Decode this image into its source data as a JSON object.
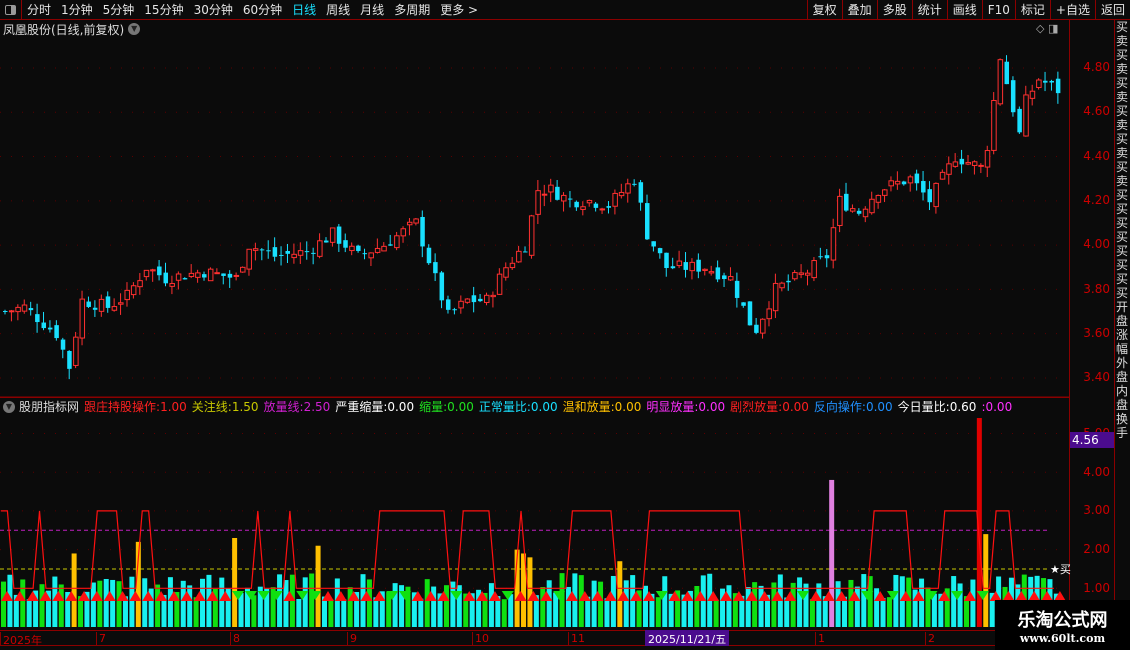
{
  "toolbar": {
    "periods": [
      "分时",
      "1分钟",
      "5分钟",
      "15分钟",
      "30分钟",
      "60分钟",
      "日线",
      "周线",
      "月线",
      "多周期",
      "更多 >"
    ],
    "active_period": "日线",
    "actions": [
      "复权",
      "叠加",
      "多股",
      "统计",
      "画线",
      "F10",
      "标记",
      "+自选",
      "返回"
    ]
  },
  "main": {
    "title": "凤凰股份(日线,前复权)",
    "price_axis": [
      "4.80",
      "4.60",
      "4.40",
      "4.20",
      "4.00",
      "3.80",
      "3.60",
      "3.40"
    ],
    "price_path": [
      [
        0,
        3.7
      ],
      [
        3,
        3.72
      ],
      [
        8,
        3.6
      ],
      [
        10,
        3.45
      ],
      [
        12,
        3.75
      ],
      [
        16,
        3.72
      ],
      [
        19,
        3.77
      ],
      [
        22,
        3.9
      ],
      [
        25,
        3.85
      ],
      [
        31,
        3.88
      ],
      [
        36,
        3.85
      ],
      [
        38,
        4.0
      ],
      [
        42,
        3.95
      ],
      [
        47,
        3.97
      ],
      [
        51,
        4.05
      ],
      [
        55,
        3.95
      ],
      [
        59,
        4.0
      ],
      [
        64,
        4.1
      ],
      [
        69,
        3.68
      ],
      [
        72,
        3.75
      ],
      [
        75,
        3.75
      ],
      [
        78,
        3.9
      ],
      [
        81,
        4.0
      ],
      [
        83,
        4.25
      ],
      [
        85,
        4.25
      ],
      [
        88,
        4.2
      ],
      [
        91,
        4.2
      ],
      [
        94,
        4.18
      ],
      [
        98,
        4.3
      ],
      [
        100,
        4.05
      ],
      [
        103,
        3.9
      ],
      [
        109,
        3.9
      ],
      [
        113,
        3.85
      ],
      [
        116,
        3.65
      ],
      [
        117,
        3.62
      ],
      [
        120,
        3.8
      ],
      [
        125,
        3.88
      ],
      [
        128,
        3.95
      ],
      [
        130,
        4.2
      ],
      [
        133,
        4.15
      ],
      [
        136,
        4.25
      ],
      [
        141,
        4.3
      ],
      [
        144,
        4.2
      ],
      [
        148,
        4.4
      ],
      [
        152,
        4.35
      ],
      [
        153,
        4.45
      ],
      [
        155,
        4.85
      ],
      [
        158,
        4.5
      ],
      [
        159,
        4.65
      ],
      [
        161,
        4.75
      ],
      [
        164,
        4.7
      ]
    ],
    "up_color": "#ff3030",
    "down_color": "#19e0ff"
  },
  "indicator": {
    "name": "股朋指标网",
    "legend": [
      {
        "label": "跟庄持股操作:",
        "value": "1.00",
        "color": "#ff2020"
      },
      {
        "label": "关注线:",
        "value": "1.50",
        "color": "#c8c800"
      },
      {
        "label": "放量线:",
        "value": "2.50",
        "color": "#d020d0"
      },
      {
        "label": "严重缩量:",
        "value": "0.00",
        "color": "#ffffff"
      },
      {
        "label": "缩量:",
        "value": "0.00",
        "color": "#20e020"
      },
      {
        "label": "正常量比:",
        "value": "0.00",
        "color": "#19e0ff"
      },
      {
        "label": "温和放量:",
        "value": "0.00",
        "color": "#ffc000"
      },
      {
        "label": "明显放量:",
        "value": "0.00",
        "color": "#ff30ff"
      },
      {
        "label": "剧烈放量:",
        "value": "0.00",
        "color": "#ff2020"
      },
      {
        "label": "反向操作:",
        "value": "0.00",
        "color": "#2090ff"
      },
      {
        "label": "今日量比:",
        "value": "0.60",
        "color": "#ffffff"
      },
      {
        "label": ":",
        "value": "0.00",
        "color": "#ff30ff"
      }
    ],
    "axis": [
      "5.00",
      "4.00",
      "3.00",
      "2.00",
      "1.00"
    ],
    "focus_line": 1.5,
    "volume_line": 2.5,
    "cursor_value": "4.56",
    "buy_label": "★买",
    "highlights": [
      [
        11,
        1.9
      ],
      [
        21,
        2.2
      ],
      [
        36,
        2.3
      ],
      [
        49,
        2.1
      ],
      [
        80,
        2.0
      ],
      [
        81,
        1.9
      ],
      [
        82,
        1.8
      ],
      [
        96,
        1.7
      ],
      [
        129,
        3.8,
        "#e080e0"
      ],
      [
        152,
        5.4,
        "#e00000"
      ],
      [
        153,
        2.4
      ]
    ]
  },
  "date_axis": {
    "labels": [
      "2025年",
      "7",
      "8",
      "9",
      "10",
      "11",
      "1",
      "2"
    ],
    "cursor_date": "2025/11/21/五"
  },
  "side_panel": "买卖买卖买卖买卖买卖买卖买买买买买买买买开盘涨幅外盘内盘换手",
  "watermark": {
    "title": "乐淘公式网",
    "url": "www.60lt.com"
  }
}
